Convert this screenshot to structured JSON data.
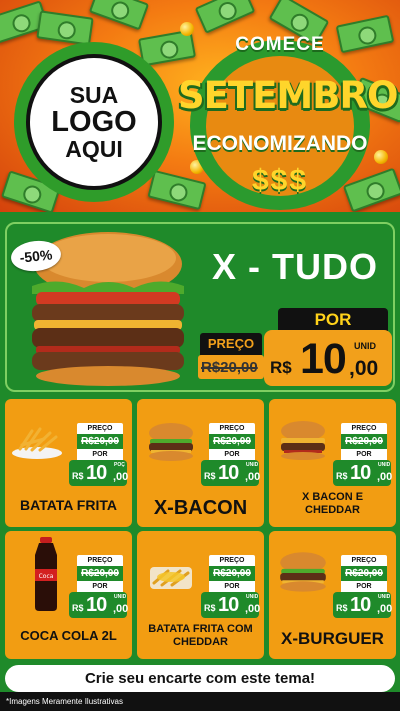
{
  "header": {
    "logo": {
      "line1": "SUA",
      "line2": "LOGO",
      "line3": "AQUI"
    },
    "promo": {
      "top": "COMECE",
      "main": "SETEMBRO",
      "sub": "ECONOMIZANDO",
      "money": "$$$"
    },
    "colors": {
      "orange": "#f47b12",
      "green": "#2b9a2e",
      "yellow": "#ffd52b"
    }
  },
  "hero": {
    "discount": "-50%",
    "title": "X - TUDO",
    "preco_label": "PREÇO",
    "old_price": "R$20,00",
    "por_label": "POR",
    "currency": "R$",
    "price_int": "10",
    "price_cents": ",00",
    "unit": "UNID",
    "image_icon": "burger-image"
  },
  "products": [
    {
      "name": "BATATA FRITA",
      "preco_label": "PREÇO",
      "old_price": "R$20,00",
      "por_label": "POR",
      "currency": "R$",
      "price_int": "10",
      "price_cents": ",00",
      "unit": "POÇ",
      "image_icon": "fries-image"
    },
    {
      "name": "X-BACON",
      "preco_label": "PREÇO",
      "old_price": "R$20,00",
      "por_label": "POR",
      "currency": "R$",
      "price_int": "10",
      "price_cents": ",00",
      "unit": "UNID",
      "image_icon": "burger-image"
    },
    {
      "name": "X BACON E CHEDDAR",
      "preco_label": "PREÇO",
      "old_price": "R$20,00",
      "por_label": "POR",
      "currency": "R$",
      "price_int": "10",
      "price_cents": ",00",
      "unit": "UNID",
      "image_icon": "burger-cheddar-image"
    },
    {
      "name": "COCA COLA 2L",
      "preco_label": "PREÇO",
      "old_price": "R$20,00",
      "por_label": "POR",
      "currency": "R$",
      "price_int": "10",
      "price_cents": ",00",
      "unit": "UNID",
      "image_icon": "soda-bottle-image"
    },
    {
      "name": "BATATA FRITA COM CHEDDAR",
      "preco_label": "PREÇO",
      "old_price": "R$20,00",
      "por_label": "POR",
      "currency": "R$",
      "price_int": "10",
      "price_cents": ",00",
      "unit": "UNID",
      "image_icon": "fries-cheddar-image"
    },
    {
      "name": "X-BURGUER",
      "preco_label": "PREÇO",
      "old_price": "R$20,00",
      "por_label": "POR",
      "currency": "R$",
      "price_int": "10",
      "price_cents": ",00",
      "unit": "UNID",
      "image_icon": "burger-image"
    }
  ],
  "footer": {
    "cta": "Crie seu encarte com este tema!",
    "disclaimer": "*Imagens Meramente Ilustrativas"
  }
}
